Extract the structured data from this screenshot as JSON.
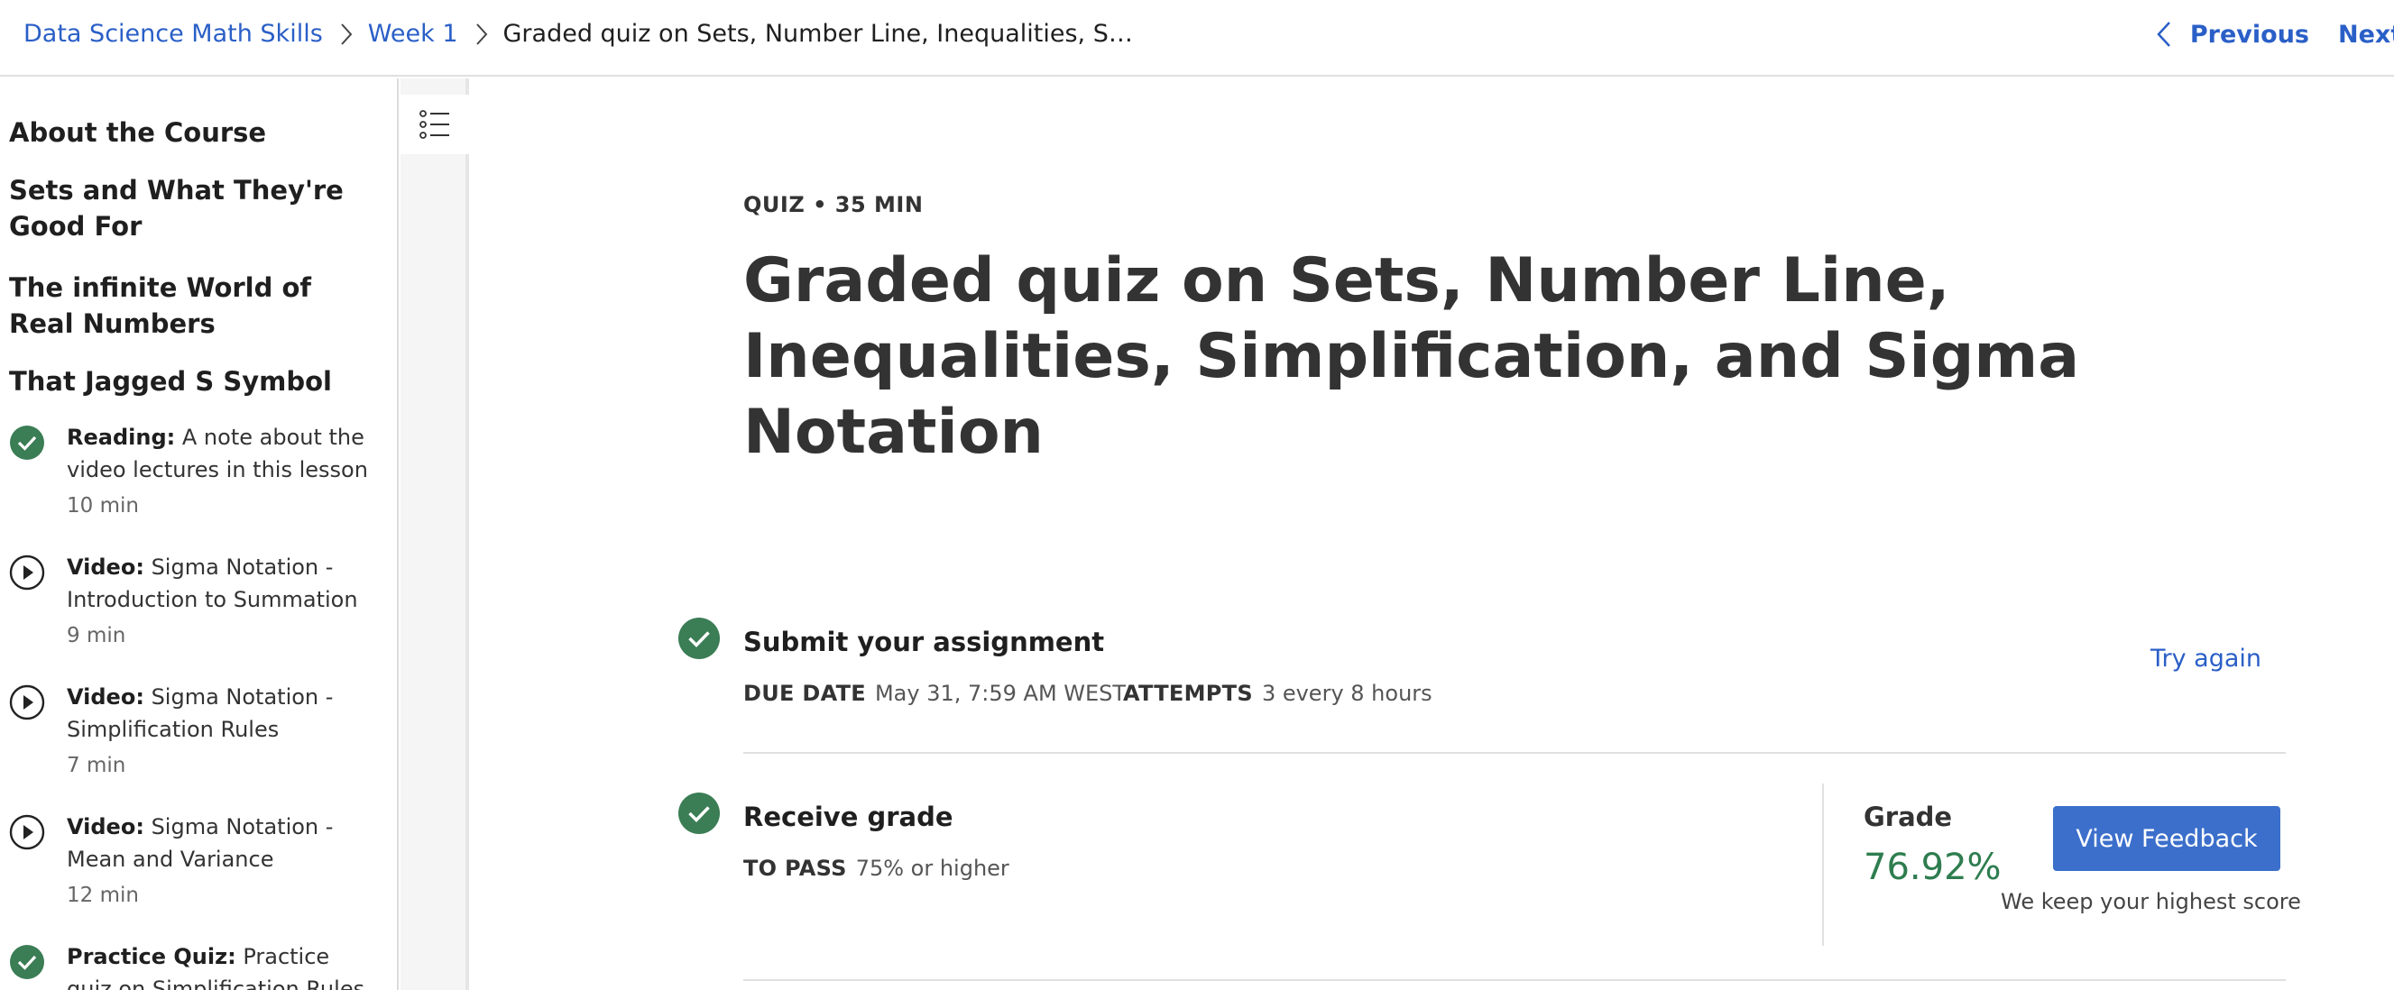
{
  "breadcrumb": {
    "course": "Data Science Math Skills",
    "week": "Week 1",
    "current": "Graded quiz on Sets, Number Line, Inequalities, S…"
  },
  "pager": {
    "previous": "Previous",
    "next": "Next"
  },
  "sidebar": {
    "sections": [
      "About the Course",
      "Sets and What They're Good For",
      "The infinite World of Real Numbers",
      "That Jagged S Symbol"
    ],
    "items": [
      {
        "type": "Reading:",
        "title": "A note about the video lectures in this lesson",
        "duration": "10 min",
        "status": "completed",
        "icon": "check-circle-icon"
      },
      {
        "type": "Video:",
        "title": "Sigma Notation - Introduction to Summation",
        "duration": "9 min",
        "status": "not-started",
        "icon": "play-circle-icon"
      },
      {
        "type": "Video:",
        "title": "Sigma Notation - Simplification Rules",
        "duration": "7 min",
        "status": "not-started",
        "icon": "play-circle-icon"
      },
      {
        "type": "Video:",
        "title": "Sigma Notation - Mean and Variance",
        "duration": "12 min",
        "status": "not-started",
        "icon": "play-circle-icon"
      },
      {
        "type": "Practice Quiz:",
        "title": "Practice quiz on Simplification Rules and",
        "duration": "",
        "status": "completed",
        "icon": "check-circle-icon"
      }
    ]
  },
  "main": {
    "meta": "QUIZ • 35 MIN",
    "title": "Graded quiz on Sets, Number Line, Inequalities, Simplification, and Sigma Notation",
    "submit": {
      "title": "Submit your assignment",
      "due_label": "DUE DATE",
      "due_value": "May 31, 7:59 AM WEST",
      "attempts_label": "ATTEMPTS",
      "attempts_value": "3 every 8 hours",
      "try_again": "Try again"
    },
    "grade": {
      "title": "Receive grade",
      "pass_label": "TO PASS",
      "pass_value": "75% or higher",
      "grade_label": "Grade",
      "grade_value": "76.92%",
      "feedback_button": "View Feedback",
      "note": "We keep your highest score"
    }
  },
  "colors": {
    "link": "#2a5fc7",
    "success": "#3b7d55",
    "grade": "#2e7d4f",
    "button": "#3b6fcb"
  }
}
